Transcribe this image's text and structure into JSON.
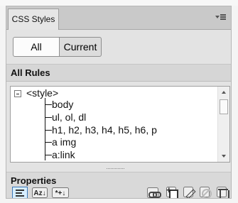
{
  "panel": {
    "tab_label": "CSS Styles"
  },
  "mode_tabs": {
    "all": "All",
    "current": "Current"
  },
  "rules": {
    "title": "All Rules",
    "items": [
      "<style>",
      "body",
      "ul, ol, dl",
      "h1, h2, h3, h4, h5, h6, p",
      "a img",
      "a:link"
    ]
  },
  "properties": {
    "title": "Properties",
    "toolbar": {
      "az_label": "Az↓",
      "set_label": "*+↓"
    }
  },
  "icons": {
    "menu": "panel-menu-icon",
    "category": "category-view-icon",
    "link": "attach-style-sheet-icon",
    "new": "new-css-rule-icon",
    "edit": "edit-style-icon",
    "disable": "disable-css-property-icon",
    "delete": "delete-css-rule-icon"
  }
}
